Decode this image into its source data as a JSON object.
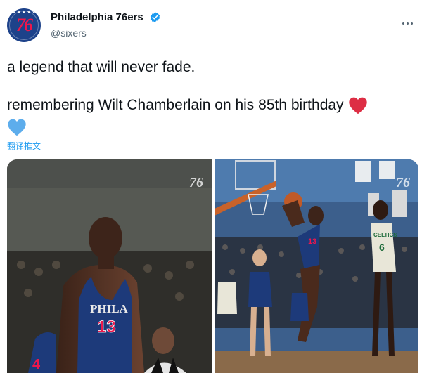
{
  "account": {
    "display_name": "Philadelphia 76ers",
    "handle": "@sixers",
    "avatar_logo": "76",
    "brand_color": "#1d428a",
    "accent_color": "#ed174c",
    "verified_color": "#1d9bf0"
  },
  "menu": {
    "icon": "more-horizontal-icon"
  },
  "tweet": {
    "line1": "a legend that will never fade.",
    "line2": "remembering Wilt Chamberlain on his 85th birthday",
    "emoji_1": "red-heart-icon",
    "emoji_2": "blue-heart-icon",
    "translate_label": "翻译推文"
  },
  "media": {
    "photo_1": {
      "watermark": "76",
      "jersey_text": "PHILA",
      "jersey_number": "13"
    },
    "photo_2": {
      "watermark": "76",
      "jersey_number": "13",
      "opponent_text": "CELTICS",
      "opponent_number": "6"
    }
  }
}
